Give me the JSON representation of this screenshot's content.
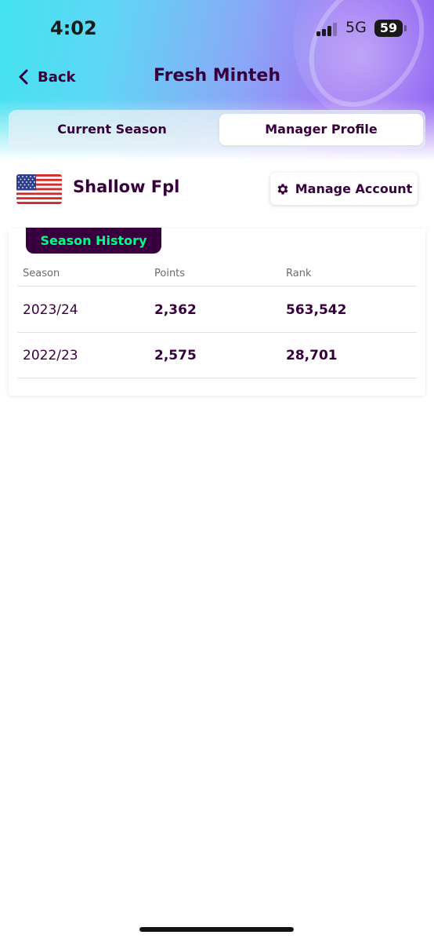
{
  "status_bar": {
    "time": "4:02",
    "network": "5G",
    "battery": "59"
  },
  "nav": {
    "back_label": "Back",
    "title": "Fresh Minteh"
  },
  "tabs": [
    {
      "label": "Current Season",
      "selected": false
    },
    {
      "label": "Manager Profile",
      "selected": true
    }
  ],
  "profile": {
    "team_name": "Shallow Fpl",
    "flag": "us-flag-icon",
    "manage_label": "Manage Account"
  },
  "season_history": {
    "title": "Season History",
    "columns": [
      "Season",
      "Points",
      "Rank"
    ],
    "rows": [
      {
        "season": "2023/24",
        "points": "2,362",
        "rank": "563,542"
      },
      {
        "season": "2022/23",
        "points": "2,575",
        "rank": "28,701"
      }
    ]
  },
  "colors": {
    "brand_purple": "#37003c",
    "brand_green": "#00ff87"
  }
}
